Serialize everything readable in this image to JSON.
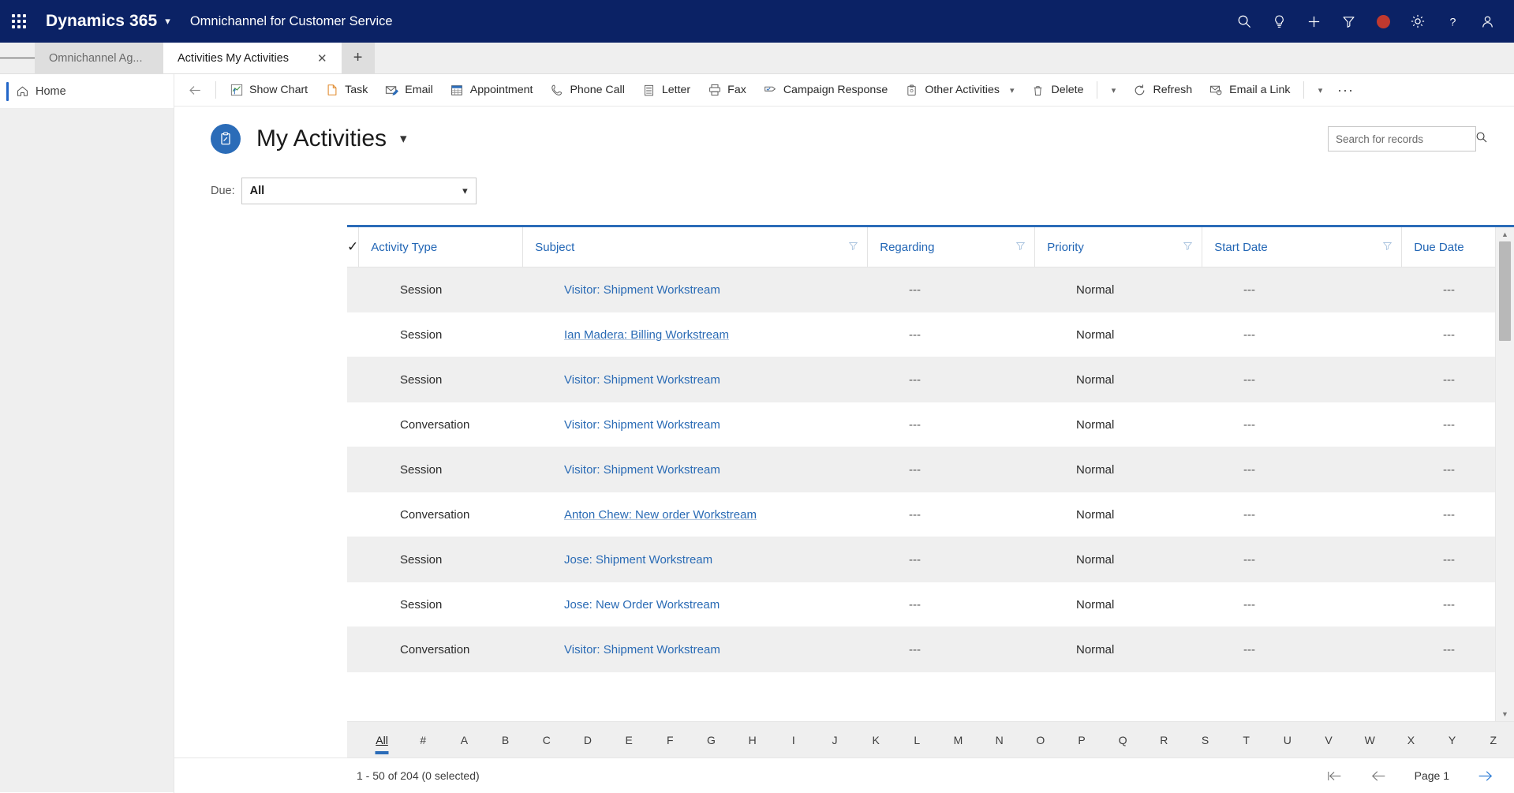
{
  "topbar": {
    "waffle_icon": "app-launcher-icon",
    "brand": "Dynamics 365",
    "brand_chevron": "chevron-down-icon",
    "app_name": "Omnichannel for Customer Service",
    "icons": [
      {
        "name": "search-icon",
        "label": "Search"
      },
      {
        "name": "lightbulb-icon",
        "label": "Assistant"
      },
      {
        "name": "plus-icon",
        "label": "New"
      },
      {
        "name": "filter-icon",
        "label": "Filter"
      },
      {
        "name": "recording-indicator-icon",
        "label": "Recording",
        "color": "#c0392f"
      },
      {
        "name": "gear-icon",
        "label": "Settings"
      },
      {
        "name": "help-icon",
        "label": "Help"
      },
      {
        "name": "user-avatar-icon",
        "label": "Account"
      }
    ],
    "accent": "#0b2265"
  },
  "tabs": {
    "hamburger_icon": "hamburger-menu-icon",
    "items": [
      {
        "label": "Omnichannel Ag...",
        "active": false
      },
      {
        "label": "Activities My Activities",
        "active": true
      }
    ],
    "close_icon": "close-icon",
    "add_label": "+"
  },
  "sidenav": {
    "items": [
      {
        "label": "Home",
        "icon": "home-icon",
        "active": true
      }
    ]
  },
  "commandbar": {
    "back_icon": "back-arrow-icon",
    "buttons": [
      {
        "label": "Show Chart",
        "icon": "chart-icon"
      },
      {
        "label": "Task",
        "icon": "task-icon"
      },
      {
        "label": "Email",
        "icon": "email-icon"
      },
      {
        "label": "Appointment",
        "icon": "calendar-icon"
      },
      {
        "label": "Phone Call",
        "icon": "phone-icon"
      },
      {
        "label": "Letter",
        "icon": "letter-icon"
      },
      {
        "label": "Fax",
        "icon": "fax-icon"
      },
      {
        "label": "Campaign Response",
        "icon": "campaign-response-icon"
      },
      {
        "label": "Other Activities",
        "icon": "other-activities-icon",
        "chevron": true
      },
      {
        "label": "Delete",
        "icon": "trash-icon"
      },
      {
        "label": "Refresh",
        "icon": "refresh-icon"
      },
      {
        "label": "Email a Link",
        "icon": "email-link-icon"
      }
    ],
    "overflow_label": "···",
    "caret_icon": "chevron-down-icon"
  },
  "page": {
    "view_icon": "clipboard-icon",
    "title": "My Activities",
    "title_chevron": "chevron-down-icon",
    "search": {
      "placeholder": "Search for records",
      "value": "",
      "icon": "search-icon"
    }
  },
  "filterbar": {
    "label": "Due:",
    "value": "All",
    "chevron": "chevron-down-icon"
  },
  "grid": {
    "select_all_icon": "checkmark-icon",
    "columns": [
      {
        "label": "Activity Type",
        "filter": false,
        "sort": null
      },
      {
        "label": "Subject",
        "filter": true,
        "sort": null
      },
      {
        "label": "Regarding",
        "filter": true,
        "sort": null
      },
      {
        "label": "Priority",
        "filter": true,
        "sort": null
      },
      {
        "label": "Start Date",
        "filter": true,
        "sort": null
      },
      {
        "label": "Due Date",
        "filter": true,
        "sort": "asc"
      }
    ],
    "rows": [
      {
        "activity_type": "Session",
        "subject": "Visitor: Shipment Workstream",
        "regarding": "---",
        "priority": "Normal",
        "start_date": "---",
        "due_date": "---",
        "hover": false
      },
      {
        "activity_type": "Session",
        "subject": "Ian Madera: Billing Workstream",
        "regarding": "---",
        "priority": "Normal",
        "start_date": "---",
        "due_date": "---",
        "hover": true
      },
      {
        "activity_type": "Session",
        "subject": "Visitor: Shipment Workstream",
        "regarding": "---",
        "priority": "Normal",
        "start_date": "---",
        "due_date": "---",
        "hover": false
      },
      {
        "activity_type": "Conversation",
        "subject": "Visitor: Shipment Workstream",
        "regarding": "---",
        "priority": "Normal",
        "start_date": "---",
        "due_date": "---",
        "hover": false
      },
      {
        "activity_type": "Session",
        "subject": "Visitor: Shipment Workstream",
        "regarding": "---",
        "priority": "Normal",
        "start_date": "---",
        "due_date": "---",
        "hover": false
      },
      {
        "activity_type": "Conversation",
        "subject": "Anton Chew: New order Workstream",
        "regarding": "---",
        "priority": "Normal",
        "start_date": "---",
        "due_date": "---",
        "hover": true
      },
      {
        "activity_type": "Session",
        "subject": "Jose: Shipment Workstream",
        "regarding": "---",
        "priority": "Normal",
        "start_date": "---",
        "due_date": "---",
        "hover": false
      },
      {
        "activity_type": "Session",
        "subject": "Jose: New Order Workstream",
        "regarding": "---",
        "priority": "Normal",
        "start_date": "---",
        "due_date": "---",
        "hover": false
      },
      {
        "activity_type": "Conversation",
        "subject": "Visitor: Shipment Workstream",
        "regarding": "---",
        "priority": "Normal",
        "start_date": "---",
        "due_date": "---",
        "hover": false
      }
    ],
    "scrollbar": {
      "up_icon": "scroll-up-icon",
      "down_icon": "scroll-down-icon"
    }
  },
  "alpha_index": {
    "items": [
      "All",
      "#",
      "A",
      "B",
      "C",
      "D",
      "E",
      "F",
      "G",
      "H",
      "I",
      "J",
      "K",
      "L",
      "M",
      "N",
      "O",
      "P",
      "Q",
      "R",
      "S",
      "T",
      "U",
      "V",
      "W",
      "X",
      "Y",
      "Z"
    ],
    "active": "All"
  },
  "footer": {
    "record_count": "1 - 50 of 204 (0 selected)",
    "page_label": "Page 1",
    "first_icon": "first-page-icon",
    "prev_icon": "previous-page-icon",
    "next_icon": "next-page-icon"
  }
}
